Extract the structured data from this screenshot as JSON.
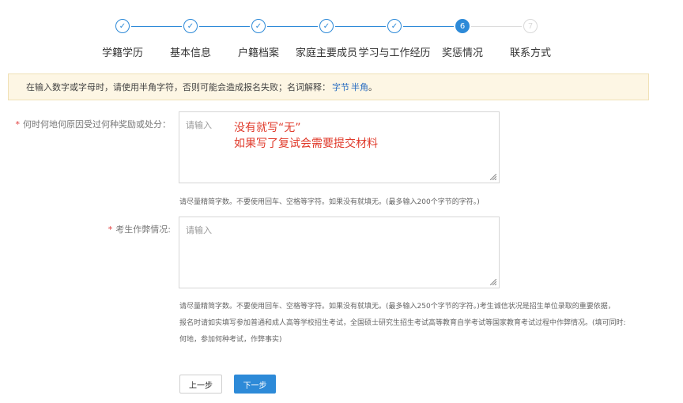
{
  "steps": [
    {
      "label": "学籍学历",
      "state": "done",
      "mark": "✓"
    },
    {
      "label": "基本信息",
      "state": "done",
      "mark": "✓"
    },
    {
      "label": "户籍档案",
      "state": "done",
      "mark": "✓"
    },
    {
      "label": "家庭主要成员",
      "state": "done",
      "mark": "✓"
    },
    {
      "label": "学习与工作经历",
      "state": "done",
      "mark": "✓"
    },
    {
      "label": "奖惩情况",
      "state": "active",
      "mark": "6"
    },
    {
      "label": "联系方式",
      "state": "todo",
      "mark": "7"
    }
  ],
  "notice": {
    "text": "在输入数字或字母时，请使用半角字符，否则可能会造成报名失败；名词解释：",
    "link1": "字节",
    "link2": "半角",
    "end": "。"
  },
  "field1": {
    "required_mark": "*",
    "label": "何时何地何原因受过何种奖励或处分：",
    "placeholder": "请输入",
    "annotation_line1": "没有就写“无”",
    "annotation_line2": "如果写了复试会需要提交材料",
    "hint": "请尽量精简字数。不要使用回车、空格等字符。如果没有就填无。(最多输入200个字节的字符。)"
  },
  "field2": {
    "required_mark": "*",
    "label": "考生作弊情况:",
    "placeholder": "请输入",
    "hint_line1": "请尽量精简字数。不要使用回车、空格等字符。如果没有就填无。(最多输入250个字节的字符。)考生诚信状况是招生单位录取的重要依据，",
    "hint_line2": "报名时请如实填写参加普通和成人高等学校招生考试，全国硕士研究生招生考试高等教育自学考试等国家教育考试过程中作弊情况。(填可同时:",
    "hint_line3": "何地，参加何种考试，作弊事实)"
  },
  "buttons": {
    "prev": "上一步",
    "next": "下一步"
  },
  "colors": {
    "accent": "#2d8ad8",
    "required": "#e23e3e",
    "annotation": "#e03a2b",
    "notice_bg": "#fdf6e4"
  }
}
